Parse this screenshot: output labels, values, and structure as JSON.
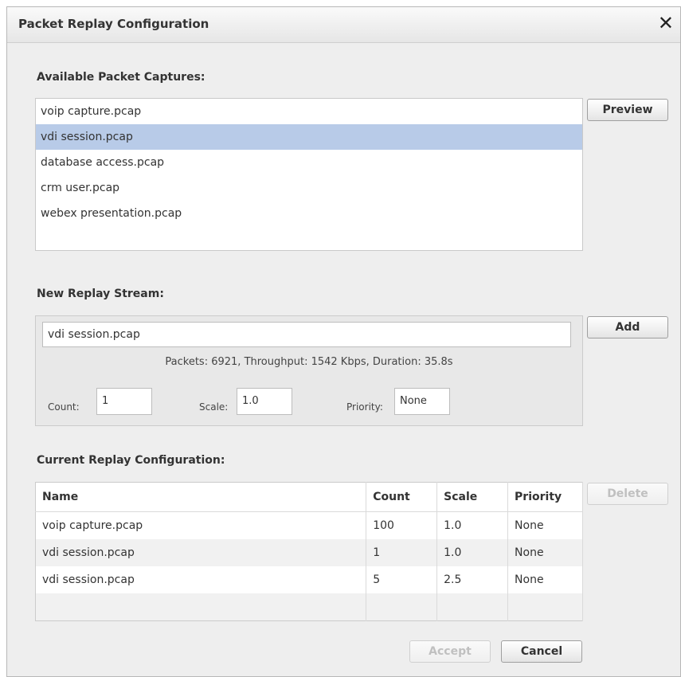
{
  "dialog": {
    "title": "Packet Replay Configuration",
    "close_glyph": "✕"
  },
  "available": {
    "label": "Available Packet Captures:",
    "items": [
      {
        "label": "voip capture.pcap",
        "selected": false
      },
      {
        "label": "vdi session.pcap",
        "selected": true
      },
      {
        "label": "database access.pcap",
        "selected": false
      },
      {
        "label": "crm user.pcap",
        "selected": false
      },
      {
        "label": "webex presentation.pcap",
        "selected": false
      }
    ],
    "preview_label": "Preview"
  },
  "new_stream": {
    "label": "New Replay Stream:",
    "name_value": "vdi session.pcap",
    "info": "Packets: 6921, Throughput: 1542 Kbps, Duration: 35.8s",
    "count_label": "Count:",
    "count_value": "1",
    "scale_label": "Scale:",
    "scale_value": "1.0",
    "priority_label": "Priority:",
    "priority_value": "None",
    "add_label": "Add"
  },
  "current": {
    "label": "Current Replay Configuration:",
    "columns": [
      "Name",
      "Count",
      "Scale",
      "Priority"
    ],
    "rows": [
      [
        "voip capture.pcap",
        "100",
        "1.0",
        "None"
      ],
      [
        "vdi session.pcap",
        "1",
        "1.0",
        "None"
      ],
      [
        "vdi session.pcap",
        "5",
        "2.5",
        "None"
      ],
      [
        "",
        "",
        "",
        ""
      ]
    ],
    "delete_label": "Delete"
  },
  "footer": {
    "accept_label": "Accept",
    "cancel_label": "Cancel"
  },
  "colors": {
    "selection": "#b8cbe8",
    "dialog_bg": "#eeeeee"
  }
}
